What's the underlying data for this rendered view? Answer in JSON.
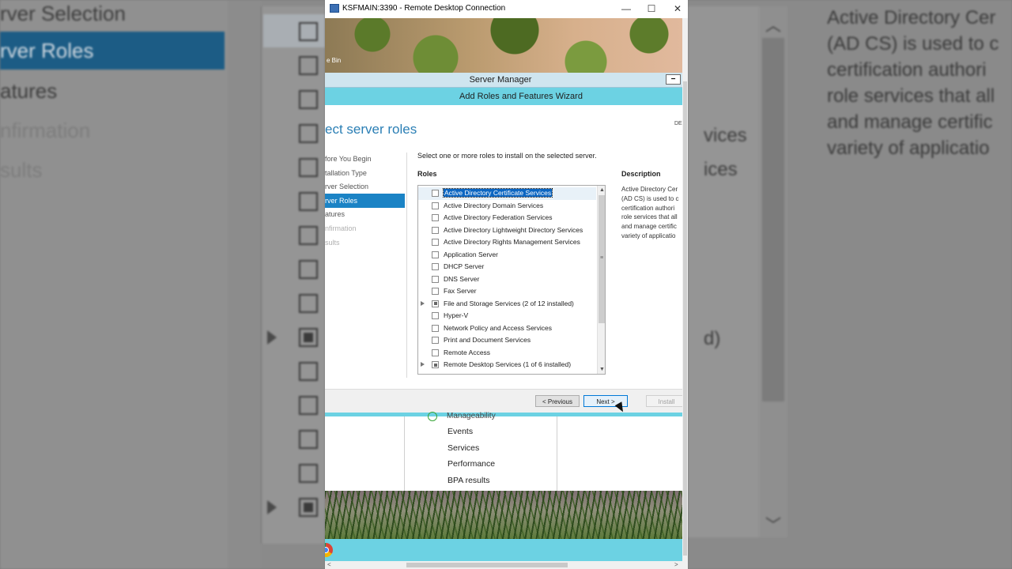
{
  "background_left": {
    "nav_items": [
      {
        "label": "rver Selection",
        "state": "normal"
      },
      {
        "label": "rver Roles",
        "state": "selected"
      },
      {
        "label": "atures",
        "state": "normal"
      },
      {
        "label": "nfirmation",
        "state": "dim"
      },
      {
        "label": "sults",
        "state": "dim"
      }
    ]
  },
  "background_right": {
    "list_fragments": [
      "vices",
      "ices",
      "d)"
    ],
    "description_lines": [
      "Active Directory Cer",
      "(AD CS) is used to c",
      "certification authori",
      "role services that all",
      "and manage certific",
      "variety of applicatio"
    ]
  },
  "rdp": {
    "title": "KSFMAIN:3390 - Remote Desktop Connection",
    "controls": {
      "minimize": "—",
      "maximize": "☐",
      "close": "✕"
    },
    "recycle_bin": "e Bin"
  },
  "server_manager": {
    "title": "Server Manager",
    "minimize": "−",
    "lower_cut_text": "Manageability",
    "lower_links": [
      "Events",
      "Services",
      "Performance",
      "BPA results"
    ]
  },
  "wizard": {
    "title": "Add Roles and Features Wizard",
    "page_title": "ect server roles",
    "destination": "DE",
    "steps": [
      {
        "label": "fore You Begin",
        "state": "normal"
      },
      {
        "label": "tallation Type",
        "state": "normal"
      },
      {
        "label": "rver Selection",
        "state": "normal"
      },
      {
        "label": "rver Roles",
        "state": "active"
      },
      {
        "label": "atures",
        "state": "normal"
      },
      {
        "label": "nfirmation",
        "state": "dim"
      },
      {
        "label": "sults",
        "state": "dim"
      }
    ],
    "instruction": "Select one or more roles to install on the selected server.",
    "roles_label": "Roles",
    "description_label": "Description",
    "description_lines": [
      "Active Directory Cer",
      "(AD CS) is used to c",
      "certification authori",
      "role services that all",
      "and manage certific",
      "variety of applicatio"
    ],
    "roles": [
      {
        "label": "Active Directory Certificate Services",
        "expandable": false,
        "checked": "none",
        "selected": true
      },
      {
        "label": "Active Directory Domain Services",
        "expandable": false,
        "checked": "none",
        "selected": false
      },
      {
        "label": "Active Directory Federation Services",
        "expandable": false,
        "checked": "none",
        "selected": false
      },
      {
        "label": "Active Directory Lightweight Directory Services",
        "expandable": false,
        "checked": "none",
        "selected": false
      },
      {
        "label": "Active Directory Rights Management Services",
        "expandable": false,
        "checked": "none",
        "selected": false
      },
      {
        "label": "Application Server",
        "expandable": false,
        "checked": "none",
        "selected": false
      },
      {
        "label": "DHCP Server",
        "expandable": false,
        "checked": "none",
        "selected": false
      },
      {
        "label": "DNS Server",
        "expandable": false,
        "checked": "none",
        "selected": false
      },
      {
        "label": "Fax Server",
        "expandable": false,
        "checked": "none",
        "selected": false
      },
      {
        "label": "File and Storage Services (2 of 12 installed)",
        "expandable": true,
        "checked": "partial",
        "selected": false
      },
      {
        "label": "Hyper-V",
        "expandable": false,
        "checked": "none",
        "selected": false
      },
      {
        "label": "Network Policy and Access Services",
        "expandable": false,
        "checked": "none",
        "selected": false
      },
      {
        "label": "Print and Document Services",
        "expandable": false,
        "checked": "none",
        "selected": false
      },
      {
        "label": "Remote Access",
        "expandable": false,
        "checked": "none",
        "selected": false
      },
      {
        "label": "Remote Desktop Services (1 of 6 installed)",
        "expandable": true,
        "checked": "partial",
        "selected": false
      }
    ],
    "buttons": {
      "previous": "< Previous",
      "next": "Next >",
      "install": "Install"
    }
  },
  "colors": {
    "accent_teal": "#6cd2e3",
    "selection_blue": "#1b83c5",
    "title_blue": "#2b7fb5"
  }
}
